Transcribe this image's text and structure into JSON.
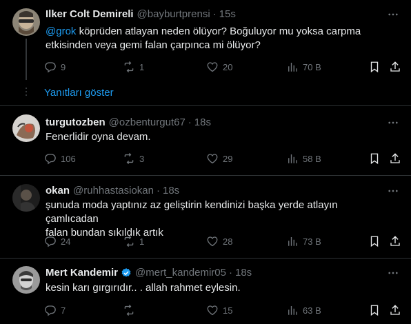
{
  "colors": {
    "background": "#000000",
    "text": "#e7e9ea",
    "muted": "#71767b",
    "link": "#1d9bf0",
    "divider": "#2f3336",
    "verified": "#1d9bf0"
  },
  "thread": {
    "show_replies_label": "Yanıtları göster"
  },
  "tweets": [
    {
      "name": "Ilker Colt Demireli",
      "handle": "@bayburtprensi",
      "sep": "·",
      "time": "15s",
      "mention": "@grok",
      "text_line1": " köprüden atlayan neden ölüyor? Boğuluyor mu yoksa carpma",
      "text_line2": "etkisinden veya gemi falan çarpınca mi ölüyor?",
      "replies": "9",
      "reposts": "1",
      "likes": "20",
      "views": "70 B",
      "icons": [
        "reply-icon",
        "repost-icon",
        "like-icon",
        "views-icon",
        "bookmark-icon",
        "share-icon",
        "more-icon"
      ]
    },
    {
      "name": "turgutozben",
      "handle": "@ozbenturgut67",
      "sep": "·",
      "time": "18s",
      "text_line1": "Fenerlidir oyna devam.",
      "replies": "106",
      "reposts": "3",
      "likes": "29",
      "views": "58 B"
    },
    {
      "name": "okan",
      "handle": "@ruhhastasiokan",
      "sep": "·",
      "time": "18s",
      "text_line1": "şunuda moda yaptınız az geliştirin kendinizi başka yerde atlayın çamlıcadan",
      "text_line2": "falan bundan sıkıldık artık",
      "replies": "24",
      "reposts": "1",
      "likes": "28",
      "views": "73 B"
    },
    {
      "name": "Mert Kandemir",
      "handle": "@mert_kandemir05",
      "sep": "·",
      "time": "18s",
      "verified": true,
      "text_line1": "kesin karı gırgırıdır.. . allah rahmet eylesin.",
      "replies": "7",
      "reposts": "",
      "likes": "15",
      "views": "63 B"
    }
  ]
}
